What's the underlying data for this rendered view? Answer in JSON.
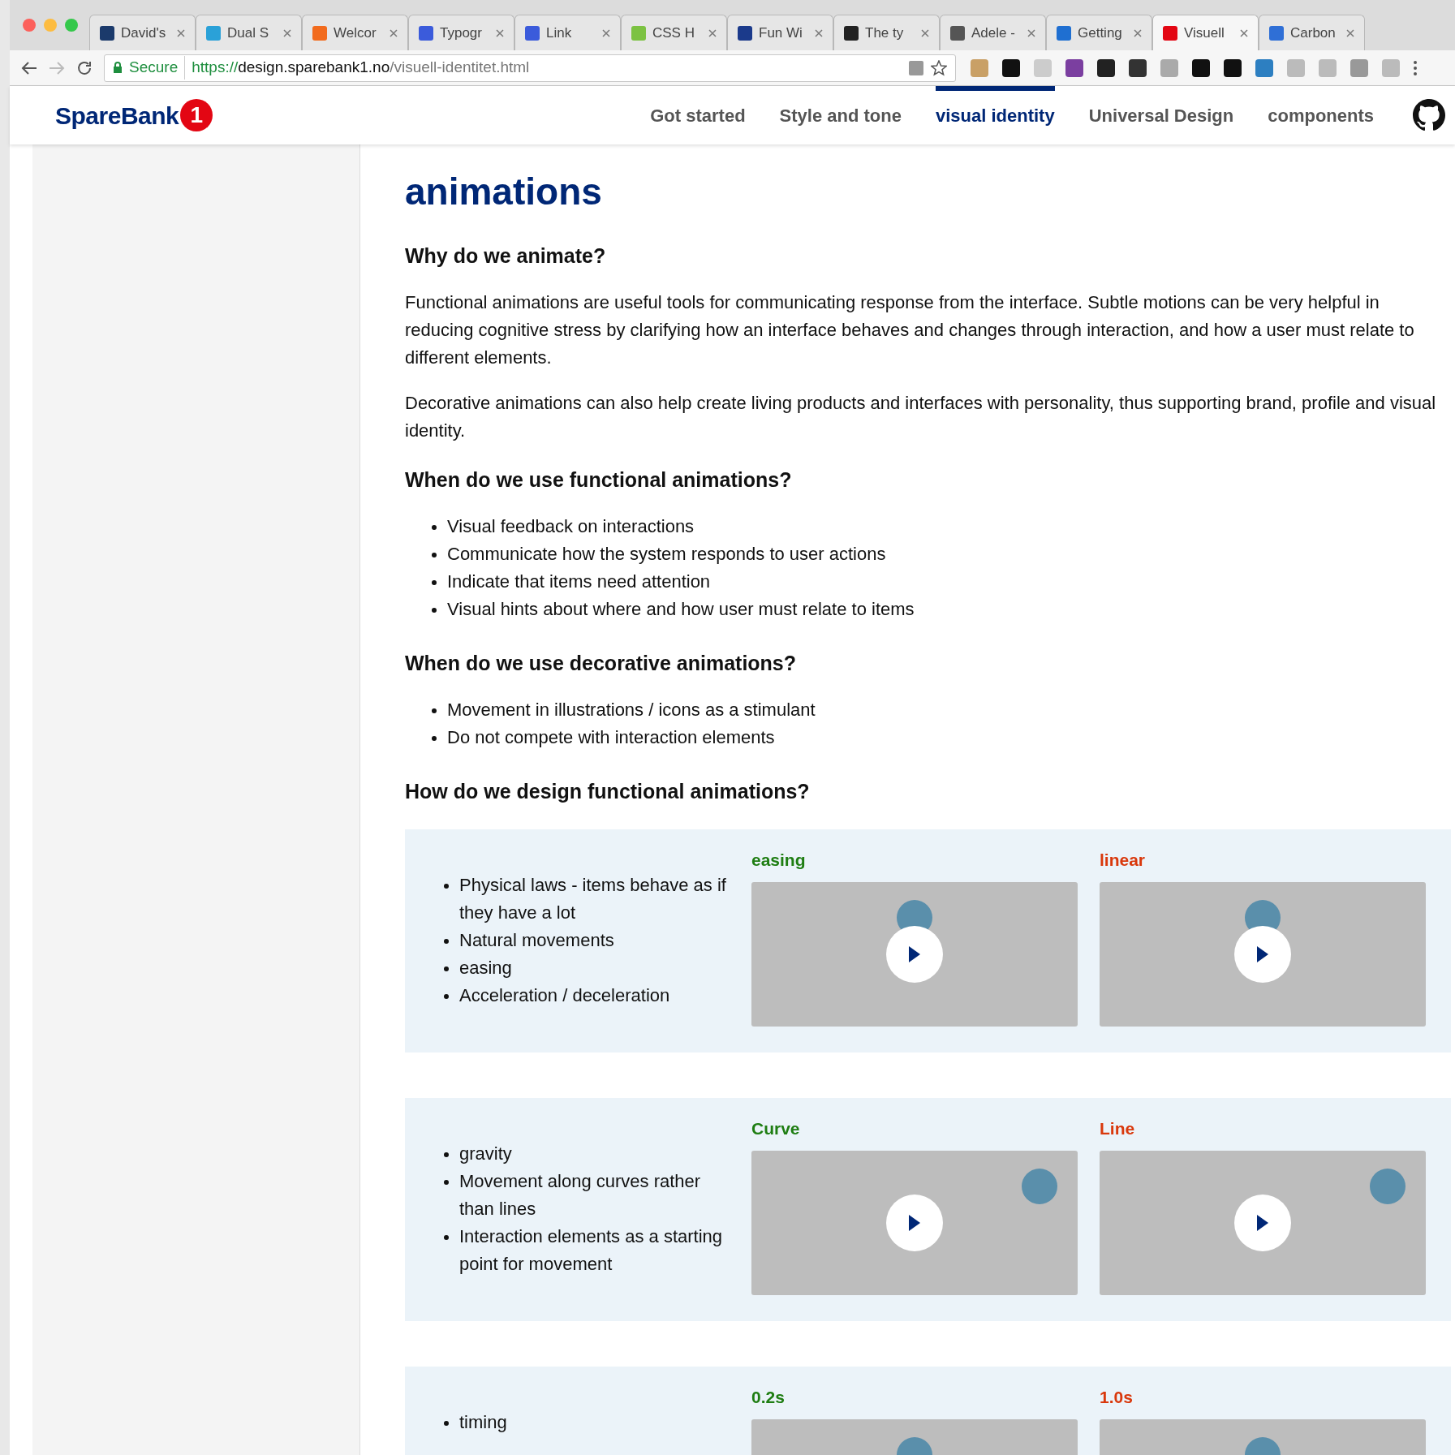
{
  "tabs": [
    {
      "label": "David's",
      "selected": false,
      "color": "#1b3a6b"
    },
    {
      "label": "Dual S",
      "selected": false,
      "color": "#2aa1d8"
    },
    {
      "label": "Welcor",
      "selected": false,
      "color": "#f26b1d"
    },
    {
      "label": "Typogr",
      "selected": false,
      "color": "#3b5bdb"
    },
    {
      "label": "Link",
      "selected": false,
      "color": "#3b5bdb"
    },
    {
      "label": "CSS H",
      "selected": false,
      "color": "#7cc242"
    },
    {
      "label": "Fun Wi",
      "selected": false,
      "color": "#1b3a8b"
    },
    {
      "label": "The ty",
      "selected": false,
      "color": "#222222"
    },
    {
      "label": "Adele -",
      "selected": false,
      "color": "#555555"
    },
    {
      "label": "Getting",
      "selected": false,
      "color": "#1f6fd1"
    },
    {
      "label": "Visuell",
      "selected": true,
      "color": "#e30613"
    },
    {
      "label": "Carbon",
      "selected": false,
      "color": "#2f6fd6"
    }
  ],
  "address": {
    "secure_label": "Secure",
    "scheme": "https://",
    "host": "design.sparebank1.no",
    "path": "/visuell-identitet.html"
  },
  "site": {
    "logo_text": "SpareBank",
    "logo_mark": "1",
    "nav": [
      {
        "label": "Got started",
        "selected": false
      },
      {
        "label": "Style and tone",
        "selected": false
      },
      {
        "label": "visual identity",
        "selected": true
      },
      {
        "label": "Universal Design",
        "selected": false
      },
      {
        "label": "components",
        "selected": false
      }
    ]
  },
  "title": "animations",
  "content": [
    {
      "kind": "heading",
      "text": "Why do we animate?"
    },
    {
      "kind": "paragraph",
      "text": "Functional animations are useful tools for communicating response from the interface. Subtle motions can be very helpful in reducing cognitive stress by clarifying how an interface behaves and changes through interaction, and how a user must relate to different elements."
    },
    {
      "kind": "paragraph",
      "text": "Decorative animations can also help create living products and interfaces with personality, thus supporting brand, profile and visual identity."
    },
    {
      "kind": "heading",
      "text": "When do we use functional animations?"
    },
    {
      "kind": "list",
      "items": [
        "Visual feedback on interactions",
        "Communicate how the system responds to user actions",
        "Indicate that items need attention",
        "Visual hints about where and how user must relate to items"
      ]
    },
    {
      "kind": "heading",
      "text": "When do we use decorative animations?"
    },
    {
      "kind": "list",
      "items": [
        "Movement in illustrations / icons as a stimulant",
        "Do not compete with interaction elements"
      ]
    },
    {
      "kind": "heading",
      "text": "How do we design functional animations?"
    }
  ],
  "demos": [
    {
      "bullets": [
        "Physical laws - items behave as if they have a lot",
        "Natural movements",
        "easing",
        "Acceleration / deceleration"
      ],
      "panels": [
        {
          "label": "easing",
          "color": "#1e7d12",
          "kind": "center"
        },
        {
          "label": "linear",
          "color": "#d9380c",
          "kind": "center"
        }
      ]
    },
    {
      "bullets": [
        "gravity",
        "Movement along curves rather than lines",
        "Interaction elements as a starting point for movement"
      ],
      "panels": [
        {
          "label": "Curve",
          "color": "#1e7d12",
          "kind": "corner"
        },
        {
          "label": "Line",
          "color": "#d9380c",
          "kind": "corner"
        }
      ]
    },
    {
      "bullets": [
        "timing"
      ],
      "panels": [
        {
          "label": "0.2s",
          "color": "#1e7d12",
          "kind": "center"
        },
        {
          "label": "1.0s",
          "color": "#d9380c",
          "kind": "center"
        }
      ]
    }
  ]
}
